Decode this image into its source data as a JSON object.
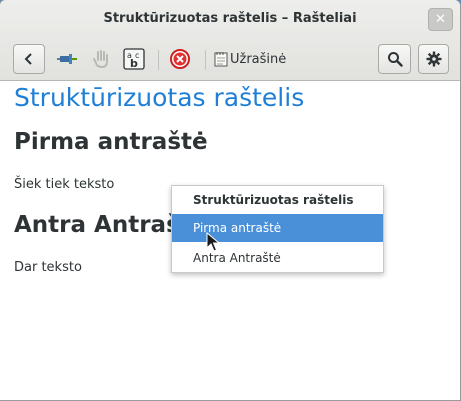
{
  "window": {
    "title": "Struktūrizuotas raštelis – Rašteliai",
    "close_glyph": "✕"
  },
  "toolbar": {
    "back_icon": "chevron-left-icon",
    "pin_icon": "pin-icon",
    "drag_icon": "hand-icon",
    "spelling_icon": "spell-check-icon",
    "delete_icon": "delete-circle-icon",
    "notes_label": "Užrašinė",
    "notes_icon": "notepad-icon",
    "search_icon": "search-icon",
    "settings_icon": "gear-icon"
  },
  "document": {
    "title": "Struktūrizuotas raštelis",
    "heading1": "Pirma antraštė",
    "paragraph1": "Šiek tiek teksto",
    "heading2": "Antra Antraštė",
    "paragraph2": "Dar teksto"
  },
  "popup": {
    "header": "Struktūrizuotas raštelis",
    "items": [
      {
        "label": "Pirma antraštė",
        "selected": true
      },
      {
        "label": "Antra Antraštė",
        "selected": false
      }
    ]
  },
  "colors": {
    "title_blue": "#1f7fd6",
    "selection_blue": "#4a90d9",
    "desktop": "#5b8bbf"
  }
}
